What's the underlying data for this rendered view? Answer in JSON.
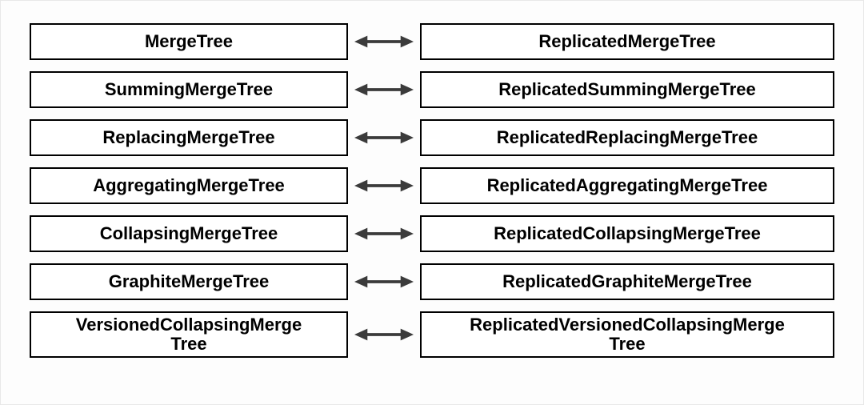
{
  "rows": [
    {
      "left": "MergeTree",
      "right": "ReplicatedMergeTree",
      "tall": false
    },
    {
      "left": "SummingMergeTree",
      "right": "ReplicatedSummingMergeTree",
      "tall": false
    },
    {
      "left": "ReplacingMergeTree",
      "right": "ReplicatedReplacingMergeTree",
      "tall": false
    },
    {
      "left": "AggregatingMergeTree",
      "right": "ReplicatedAggregatingMergeTree",
      "tall": false
    },
    {
      "left": "CollapsingMergeTree",
      "right": "ReplicatedCollapsingMergeTree",
      "tall": false
    },
    {
      "left": "GraphiteMergeTree",
      "right": "ReplicatedGraphiteMergeTree",
      "tall": false
    },
    {
      "left": "VersionedCollapsingMerge\nTree",
      "right": "ReplicatedVersionedCollapsingMerge\nTree",
      "tall": true
    }
  ]
}
